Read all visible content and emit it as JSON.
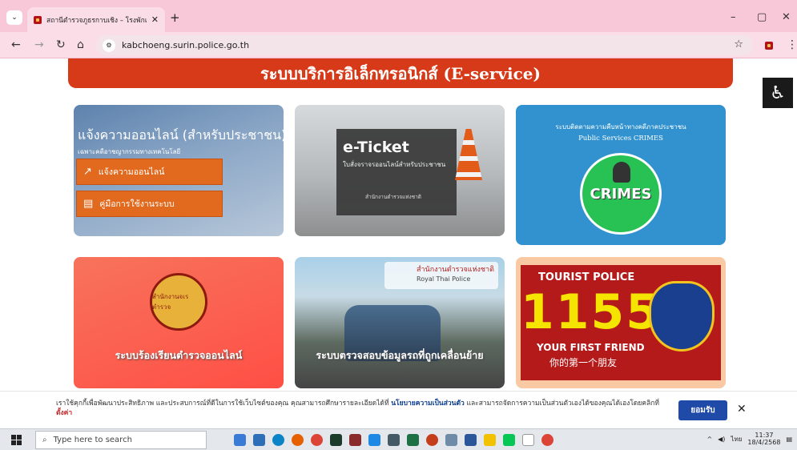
{
  "browser": {
    "tab_title": "สถานีตำรวจภูธรกาบเชิง – โรงพักแห่ง",
    "url": "kabchoeng.surin.police.go.th"
  },
  "page": {
    "banner_title": "ระบบบริการอิเล็กทรอนิกส์ (E-service)",
    "cards": {
      "report": {
        "title": "แจ้งความออนไลน์ (สำหรับประชาชน)",
        "subtitle": "เฉพาะคดีอาชญากรรมทางเทคโนโลยี",
        "button1": "แจ้งความออนไลน์",
        "button2": "คู่มือการใช้งานระบบ"
      },
      "eticket": {
        "title": "e-Ticket",
        "subtitle": "ใบสั่งจราจรออนไลน์สำหรับประชาชน",
        "org": "สำนักงานตำรวจแห่งชาติ"
      },
      "crimes": {
        "top": "ระบบติดตามความคืบหน้าทางคดีภาคประชาชน",
        "sub": "Public Services CRIMES",
        "word": "CRIMES"
      },
      "complaint": {
        "caption": "ระบบร้องเรียนตำรวจออนไลน์",
        "seal_text": "สำนักงานจเรตำรวจ"
      },
      "vehicle": {
        "badge_th": "สำนักงานตำรวจแห่งชาติ",
        "badge_en": "Royal Thai Police",
        "caption": "ระบบตรวจสอบข้อมูลรถที่ถูกเคลื่อนย้าย"
      },
      "tourist": {
        "title": "TOURIST POLICE",
        "number": "1155",
        "friend": "YOUR FIRST FRIEND",
        "chinese": "你的第一个朋友"
      }
    }
  },
  "cookie": {
    "text_before": "เราใช้คุกกี้เพื่อพัฒนาประสิทธิภาพ และประสบการณ์ที่ดีในการใช้เว็บไซต์ของคุณ คุณสามารถศึกษารายละเอียดได้ที่ ",
    "policy_link": "นโยบายความเป็นส่วนตัว",
    "text_after": " และสามารถจัดการความเป็นส่วนตัวเองได้ของคุณได้เองโดยคลิกที่ ",
    "settings_link": "ตั้งค่า",
    "accept": "ยอมรับ"
  },
  "taskbar": {
    "search_placeholder": "Type here to search",
    "time": "11:37",
    "date": "18/4/2568",
    "lang": "ไทย"
  }
}
